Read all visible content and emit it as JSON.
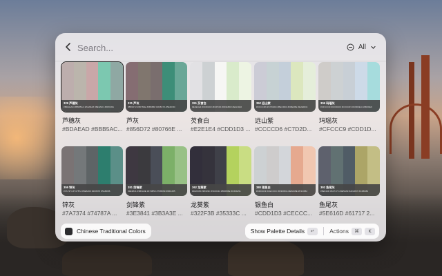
{
  "search": {
    "placeholder": "Search..."
  },
  "filter": {
    "label": "All"
  },
  "icons": {
    "back": "chevron-left-icon",
    "filter": "circle-minus-icon",
    "dropdown": "chevron-down-icon",
    "enter_key": "return-key-icon",
    "command_key": "command-key-icon"
  },
  "palettes": [
    {
      "name": "芦穗灰",
      "hex_text": "#BDAEAD #BBB5AC...",
      "title": "329 芦穗灰",
      "codes": "#BDAEAD #BBB5AC #A9A8A8 #8E9A9C #6F8C8A",
      "colors": [
        "#BDAEAD",
        "#BBB5AC",
        "#C9A7A8",
        "#7CC8B0",
        "#8FA8A3"
      ],
      "selected": true
    },
    {
      "name": "芦灰",
      "hex_text": "#856D72 #80766E ...",
      "title": "331 芦灰",
      "codes": "#856D72 #80766E #6B6868 #3F8C7A #5E9C8C",
      "colors": [
        "#856D72",
        "#80766E",
        "#7A6E6E",
        "#3D8E78",
        "#6AA797"
      ],
      "selected": false
    },
    {
      "name": "芡食白",
      "hex_text": "#E2E1E4 #CDD1D3 ...",
      "title": "351 芡食白",
      "codes": "#E2E1E4 #CDD1D3 #F4F5F4 #DDE8D3 #EAF2E0",
      "colors": [
        "#E2E1E4",
        "#CDD1D3",
        "#F6F6F4",
        "#D9EBCB",
        "#EDF4E3"
      ],
      "selected": false
    },
    {
      "name": "远山紫",
      "hex_text": "#CCCCD6 #C7D2D...",
      "title": "352 远山紫",
      "codes": "#CCCCD6 #C7D2D4 #BEC9D4 #D8E4BE #E2EDD4",
      "colors": [
        "#CCCCD6",
        "#C7D2D4",
        "#C4CFDA",
        "#DCE7BE",
        "#E5EEDA"
      ],
      "selected": false
    },
    {
      "name": "玛瑙灰",
      "hex_text": "#CFCCC9 #CDD1D...",
      "title": "306 玛瑙灰",
      "codes": "#CFCCC9 #CDD1D3 #C3CCD3 #C9D6E4 #A8DDE0",
      "colors": [
        "#CFCCC9",
        "#CDD1D3",
        "#C8CFD6",
        "#CDDAE8",
        "#A6DCDD"
      ],
      "selected": false
    },
    {
      "name": "锌灰",
      "hex_text": "#7A7374 #74787A ...",
      "title": "359 锌灰",
      "codes": "#7A7374 #74787A #5E6466 #2F8070 #5A8D86",
      "colors": [
        "#7A7374",
        "#74787A",
        "#5E6466",
        "#2D7E6E",
        "#5B8F88"
      ],
      "selected": false
    },
    {
      "name": "剑锋紫",
      "hex_text": "#3E3841 #3B3A3E ...",
      "title": "381 剑锋紫",
      "codes": "#3E3841 #3B3A3E #474B53 #7FB069 #9BC285",
      "colors": [
        "#3E3841",
        "#3B3A3E",
        "#4A4E58",
        "#7CB068",
        "#98C186"
      ],
      "selected": false
    },
    {
      "name": "龙葵紫",
      "hex_text": "#322F3B #35333C ...",
      "title": "362 龙葵紫",
      "codes": "#322F3B #35333C #3C3D44 #B6D65E #C6DE7E",
      "colors": [
        "#322F3B",
        "#35333C",
        "#3F4048",
        "#B4D25E",
        "#C9DD83"
      ],
      "selected": false
    },
    {
      "name": "银鱼白",
      "hex_text": "#CDD1D3 #CECCC...",
      "title": "380 银鱼白",
      "codes": "#CDD1D3 #CECCCC #D3D6DA #E8A68E #F3C6B2",
      "colors": [
        "#CDD1D3",
        "#CECCCC",
        "#D3D6DA",
        "#E6A98F",
        "#F1C7B1"
      ],
      "selected": false
    },
    {
      "name": "鱼尾灰",
      "hex_text": "#5E616D #61717 2...",
      "title": "392 鱼尾灰",
      "codes": "#5E616D #617172 #4E5A63 #AFA867 #C2BD82",
      "colors": [
        "#5E616D",
        "#617172",
        "#505C66",
        "#ACA567",
        "#C3BE85"
      ],
      "selected": false
    }
  ],
  "footer": {
    "extension_name": "Chinese Traditional Colors",
    "primary_action": "Show Palette Details",
    "enter_key": "↵",
    "actions_label": "Actions",
    "cmd_key": "⌘",
    "k_key": "K"
  }
}
